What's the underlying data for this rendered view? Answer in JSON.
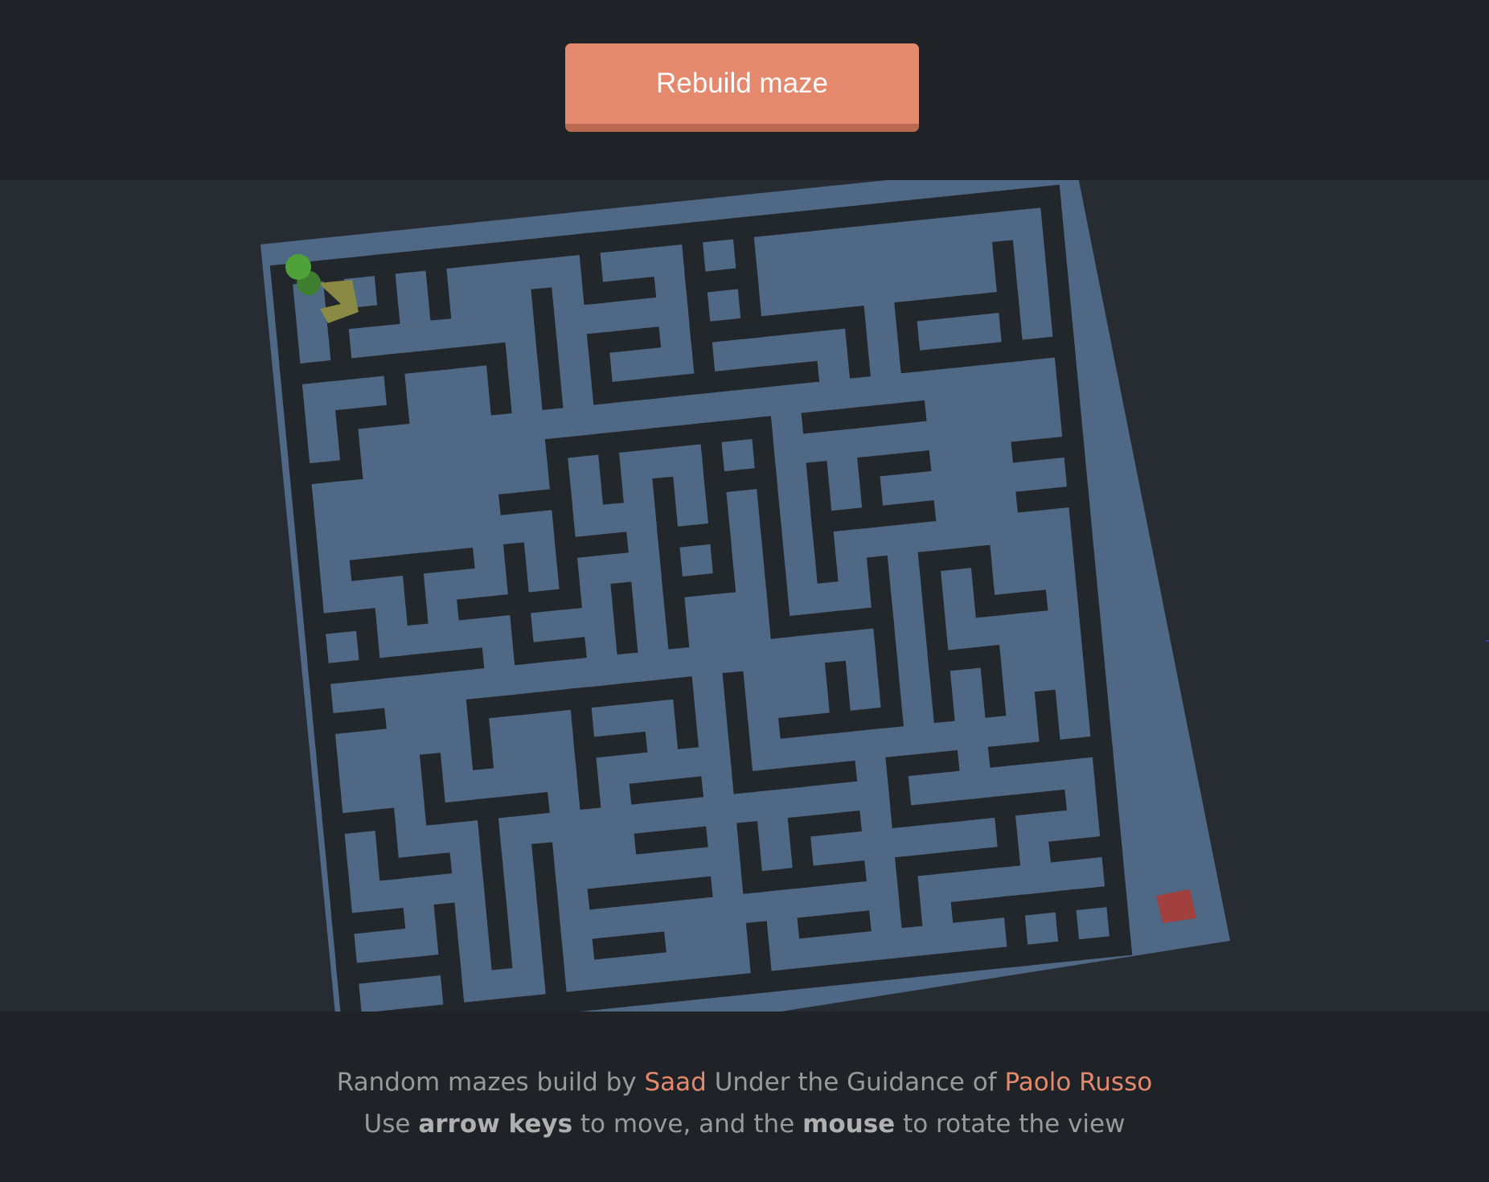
{
  "toolbar": {
    "rebuild_label": "Rebuild maze"
  },
  "maze": {
    "colors": {
      "background": "#262c31",
      "floor": "#4f6886",
      "wall": "#22272c",
      "player": "#4fa23a",
      "trail": "#8a8a45",
      "goal": "#a2403e"
    }
  },
  "footer": {
    "line1_prefix": "Random mazes build by ",
    "author": "Saad",
    "line1_middle": " Under the Guidance of ",
    "mentor": "Paolo Russo",
    "line2_prefix": "Use ",
    "line2_keys": "arrow keys",
    "line2_middle": " to move, and the ",
    "line2_mouse": "mouse",
    "line2_suffix": " to rotate the view"
  }
}
